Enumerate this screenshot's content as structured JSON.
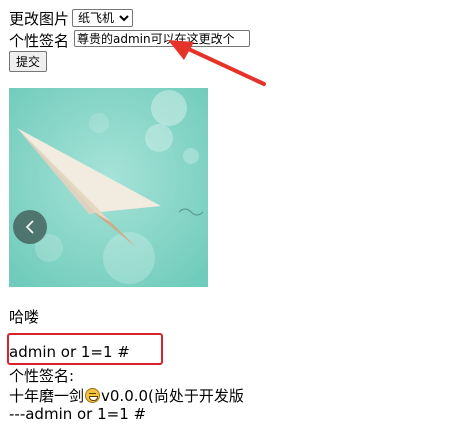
{
  "form": {
    "change_image_label": "更改图片",
    "image_select_value": "纸飞机",
    "signature_label": "个性签名",
    "signature_value": "尊贵的admin可以在这更改个",
    "submit_label": "提交"
  },
  "profile": {
    "greeting": "哈喽",
    "username": "admin or 1=1 #",
    "signature_heading": "个性签名:",
    "signature_text_before": "十年磨一剑",
    "emoji_icon": "grinning-sweat-face",
    "signature_text_after": "v0.0.0(尚处于开发版",
    "signature_author": "---admin or 1=1 #"
  },
  "annotations": {
    "highlight_color": "#d9222a"
  }
}
